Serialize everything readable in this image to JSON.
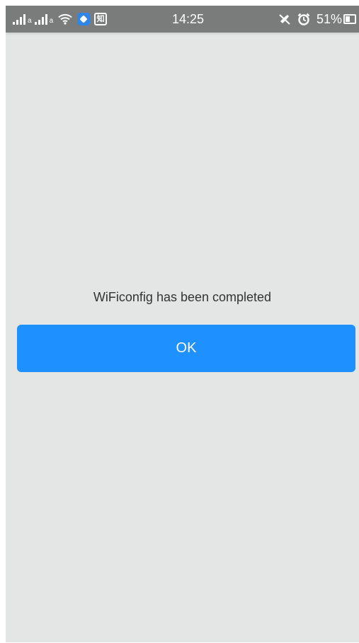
{
  "status_bar": {
    "carrier_1_type": "a",
    "carrier_2_type": "a",
    "notification_icons": [
      "blue-app-icon",
      "zhihu-icon"
    ],
    "zhihu_glyph": "知",
    "time": "14:25",
    "status_icons": [
      "mute-icon",
      "alarm-icon"
    ],
    "battery_percent": "51%",
    "battery_level": 0.51
  },
  "dialog": {
    "message": "WiFiconfig has been completed",
    "ok_label": "OK"
  },
  "colors": {
    "background": "#e4e6e5",
    "status_bar": "#7a7c7b",
    "button": "#1e90ff",
    "button_text": "#ffffff",
    "message_text": "#333333"
  }
}
